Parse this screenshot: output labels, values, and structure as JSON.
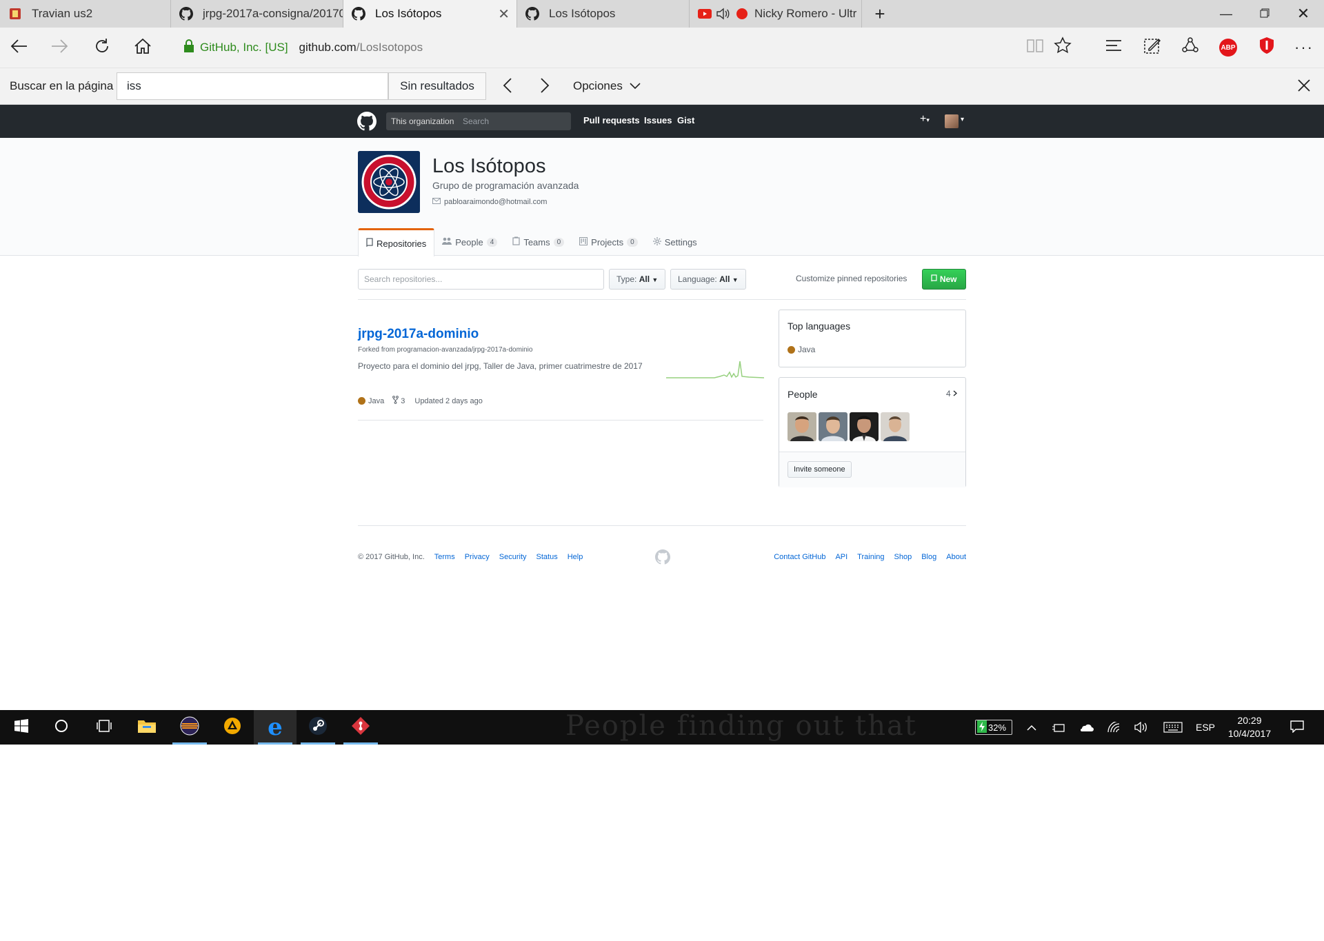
{
  "browser": {
    "tabs": [
      {
        "title": "Travian us2",
        "icon": "travian-icon"
      },
      {
        "title": "jrpg-2017a-consigna/20170",
        "icon": "github-icon"
      },
      {
        "title": "Los Isótopos",
        "icon": "github-icon",
        "active": true
      },
      {
        "title": "Los Isótopos",
        "icon": "github-icon"
      },
      {
        "title": "Nicky Romero - Ultr",
        "icon": "youtube-icon",
        "audio": true
      }
    ],
    "site_identity": "GitHub, Inc. [US]",
    "url_host": "github.com",
    "url_path": "/LosIsotopos",
    "find": {
      "label": "Buscar en la página",
      "query": "iss",
      "results": "Sin resultados",
      "options_label": "Opciones"
    },
    "abp_label": "ABP"
  },
  "github": {
    "scope_label": "This organization",
    "search_placeholder": "Search",
    "nav": [
      "Pull requests",
      "Issues",
      "Gist"
    ],
    "plus_label": "+"
  },
  "org": {
    "name": "Los Isótopos",
    "description": "Grupo de programación avanzada",
    "email": "pabloaraimondo@hotmail.com",
    "tabs": [
      {
        "label": "Repositories",
        "count": null,
        "selected": true,
        "icon": "repo-icon"
      },
      {
        "label": "People",
        "count": "4",
        "icon": "people-icon"
      },
      {
        "label": "Teams",
        "count": "0",
        "icon": "teams-icon"
      },
      {
        "label": "Projects",
        "count": "0",
        "icon": "projects-icon"
      },
      {
        "label": "Settings",
        "count": null,
        "icon": "gear-icon"
      }
    ]
  },
  "filters": {
    "search_placeholder": "Search repositories...",
    "type_label": "Type:",
    "type_value": "All",
    "language_label": "Language:",
    "language_value": "All",
    "customize": "Customize pinned repositories",
    "new_button": "New"
  },
  "repo": {
    "name": "jrpg-2017a-dominio",
    "forked_from": "Forked from programacion-avanzada/jrpg-2017a-dominio",
    "description": "Proyecto para el dominio del jrpg, Taller de Java, primer cuatrimestre de 2017",
    "language": "Java",
    "language_color": "#b07219",
    "forks": "3",
    "updated": "Updated 2 days ago"
  },
  "sidebar": {
    "top_languages_title": "Top languages",
    "languages": [
      {
        "name": "Java",
        "color": "#b07219"
      }
    ],
    "people_title": "People",
    "people_count": "4",
    "invite_label": "Invite someone"
  },
  "footer": {
    "copyright": "© 2017 GitHub, Inc.",
    "left_links": [
      "Terms",
      "Privacy",
      "Security",
      "Status",
      "Help"
    ],
    "right_links": [
      "Contact GitHub",
      "API",
      "Training",
      "Shop",
      "Blog",
      "About"
    ]
  },
  "taskbar": {
    "battery": "32%",
    "language": "ESP",
    "time": "20:29",
    "date": "10/4/2017",
    "wallpaper_text": "People finding out that"
  },
  "colors": {
    "accent_orange": "#e36209",
    "link_blue": "#0366d6",
    "new_green": "#28a745",
    "header_dark": "#24292e"
  }
}
